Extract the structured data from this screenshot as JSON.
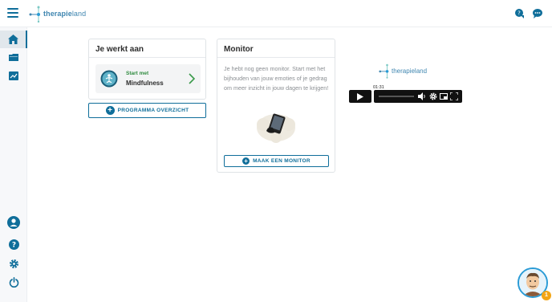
{
  "header": {
    "logo_text_bold": "therapie",
    "logo_text_light": "land"
  },
  "work_card": {
    "title": "Je werkt aan",
    "program_small": "Start met",
    "program_name": "Mindfulness",
    "overview_button": "PROGRAMMA OVERZICHT"
  },
  "monitor_card": {
    "title": "Monitor",
    "text": "Je hebt nog geen monitor. Start met het bijhouden van jouw emoties of je gedrag om meer inzicht in jouw dagen te krijgen!",
    "button": "MAAK EEN MONITOR"
  },
  "video": {
    "logo_text_bold": "therapie",
    "logo_text_light": "land",
    "time": "01:31"
  },
  "badge": {
    "count": "1"
  },
  "colors": {
    "primary": "#0f6e9a",
    "accent": "#2a9bd6",
    "green": "#2f8b3f",
    "badge": "#f2a516"
  }
}
